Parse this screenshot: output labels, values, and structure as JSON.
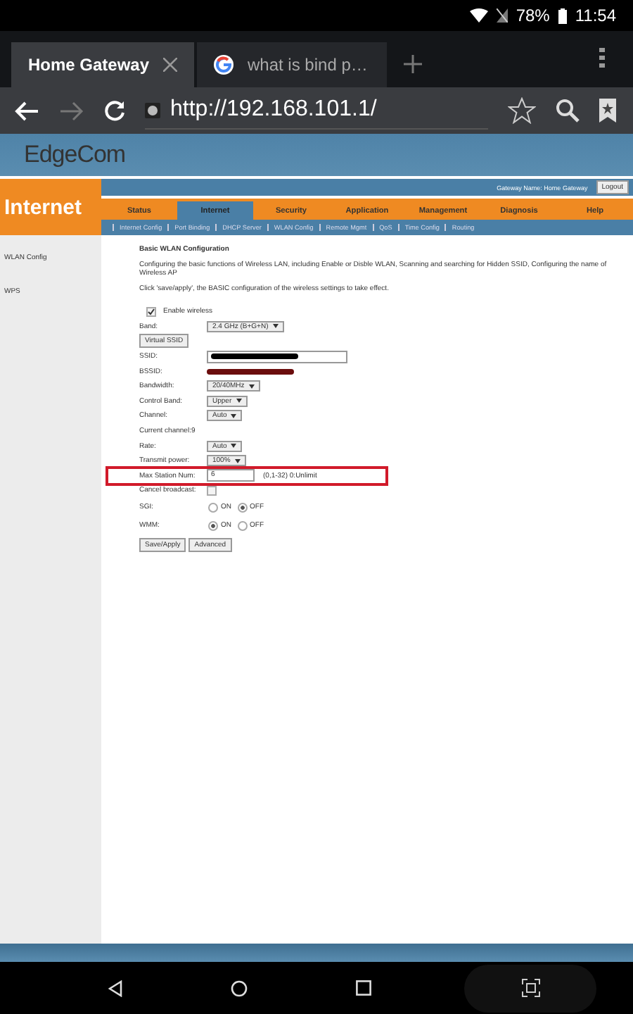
{
  "status_bar": {
    "battery": "78%",
    "time": "11:54"
  },
  "tabs": [
    {
      "label": "Home Gateway",
      "selected": true
    },
    {
      "label": "what is bind p…",
      "selected": false
    }
  ],
  "address_bar": {
    "url": "http://192.168.101.1/"
  },
  "page": {
    "logo": "EdgeCom",
    "section_title": "Internet",
    "gateway_name": "Gateway Name: Home Gateway",
    "logout": "Logout",
    "menu": [
      {
        "label": "Status",
        "selected": false
      },
      {
        "label": "Internet",
        "selected": true
      },
      {
        "label": "Security",
        "selected": false
      },
      {
        "label": "Application",
        "selected": false
      },
      {
        "label": "Management",
        "selected": false
      },
      {
        "label": "Diagnosis",
        "selected": false
      },
      {
        "label": "Help",
        "selected": false
      }
    ],
    "submenu": [
      "Internet Config",
      "Port Binding",
      "DHCP Server",
      "WLAN Config",
      "Remote Mgmt",
      "QoS",
      "Time Config",
      "Routing"
    ],
    "sidebar": [
      "WLAN Config",
      "WPS"
    ],
    "heading": "Basic WLAN Configuration",
    "description": "Configuring the basic functions of Wireless LAN, including Enable or Disble WLAN, Scanning and searching for Hidden SSID, Configuring the name of Wireless AP",
    "instruction": "Click 'save/apply', the BASIC configuration of the wireless settings to take effect.",
    "rows": [
      {
        "kind": "checkbox",
        "label": "Enable wireless",
        "checked": true
      },
      {
        "kind": "select",
        "label": "Band:",
        "value": "2.4 GHz (B+G+N)"
      },
      {
        "kind": "button",
        "label": "Virtual SSID"
      },
      {
        "kind": "redacted-input",
        "label": "SSID:"
      },
      {
        "kind": "redacted",
        "label": "BSSID:"
      },
      {
        "kind": "select",
        "label": "Bandwidth:",
        "value": "20/40MHz"
      },
      {
        "kind": "select",
        "label": "Control Band:",
        "value": "Upper"
      },
      {
        "kind": "select",
        "label": "Channel:",
        "value": "Auto"
      },
      {
        "kind": "text",
        "label": "Current channel:9"
      },
      {
        "kind": "select",
        "label": "Rate:",
        "value": "Auto"
      },
      {
        "kind": "select",
        "label": "Transmit power:",
        "value": "100%"
      },
      {
        "kind": "input",
        "label": "Max Station Num:",
        "value": "6",
        "hint": "(0,1-32) 0:Unlimit",
        "highlighted": true
      },
      {
        "kind": "checkbox-right",
        "label": "Cancel broadcast:",
        "checked": false
      },
      {
        "kind": "radio",
        "label": "SGI:",
        "options": [
          {
            "label": "ON",
            "selected": false
          },
          {
            "label": "OFF",
            "selected": true
          }
        ]
      },
      {
        "kind": "radio",
        "label": "WMM:",
        "options": [
          {
            "label": "ON",
            "selected": true
          },
          {
            "label": "OFF",
            "selected": false
          }
        ]
      }
    ],
    "buttons": [
      "Save/Apply",
      "Advanced"
    ]
  }
}
